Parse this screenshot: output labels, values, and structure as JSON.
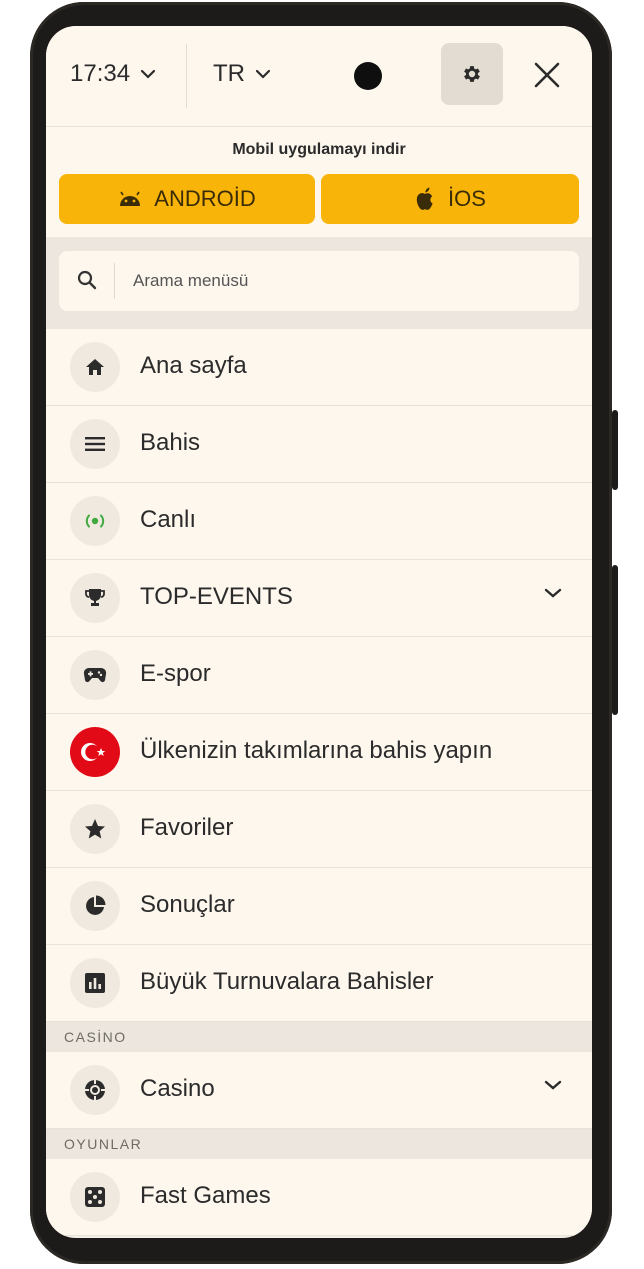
{
  "header": {
    "time": "17:34",
    "language": "TR"
  },
  "app_download": {
    "title": "Mobil uygulamayı indir",
    "android_label": "ANDROİD",
    "ios_label": "İOS"
  },
  "search": {
    "placeholder": "Arama menüsü"
  },
  "menu": {
    "items": [
      {
        "label": "Ana sayfa"
      },
      {
        "label": "Bahis"
      },
      {
        "label": "Canlı"
      },
      {
        "label": "TOP-EVENTS"
      },
      {
        "label": "E-spor"
      },
      {
        "label": "Ülkenizin takımlarına bahis yapın"
      },
      {
        "label": "Favoriler"
      },
      {
        "label": "Sonuçlar"
      },
      {
        "label": "Büyük Turnuvalara Bahisler"
      }
    ],
    "casino_section": "CASİNO",
    "casino_item": "Casino",
    "games_section": "OYUNLAR",
    "games_item": "Fast Games"
  },
  "colors": {
    "accent": "#f8b408",
    "live_green": "#3faa3f",
    "flag_red": "#e30a17"
  }
}
